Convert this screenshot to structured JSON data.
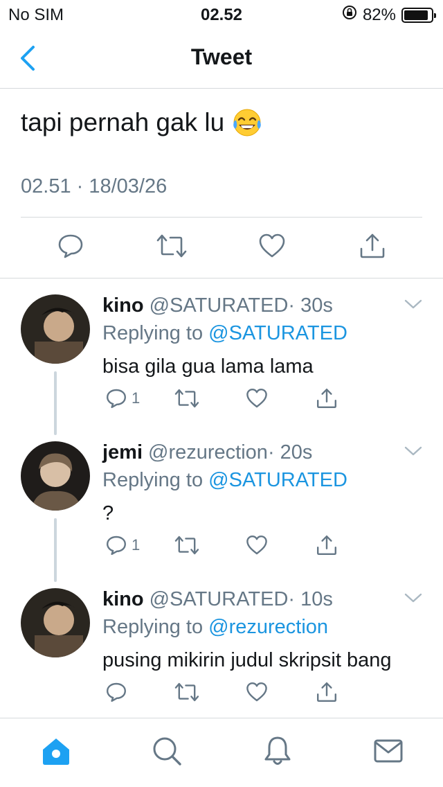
{
  "status_bar": {
    "carrier": "No SIM",
    "time": "02.52",
    "battery": "82%",
    "battery_level": 0.82
  },
  "nav": {
    "title": "Tweet",
    "back_icon": "chevron-left-icon"
  },
  "main_tweet": {
    "text": "tapi pernah gak lu",
    "emoji": "tears-of-joy-emoji",
    "date": "02.51 · 18/03/26",
    "actions": [
      "reply-icon",
      "retweet-icon",
      "like-icon",
      "share-icon"
    ]
  },
  "replies": [
    {
      "name": "kino",
      "handle": "@SATURATED",
      "time": "· 30s",
      "replying_label": "Replying to",
      "replying_to": "@SATURATED",
      "text": "bisa gila gua lama lama",
      "reply_count": "1"
    },
    {
      "name": "jemi",
      "handle": "@rezurection",
      "time": "· 20s",
      "replying_label": "Replying to",
      "replying_to": "@SATURATED",
      "text": "?",
      "reply_count": "1"
    },
    {
      "name": "kino",
      "handle": "@SATURATED",
      "time": "· 10s",
      "replying_label": "Replying to",
      "replying_to": "@rezurection",
      "text": "pusing mikirin judul skripsit bang",
      "reply_count": ""
    }
  ],
  "tab_bar": {
    "tabs": [
      "home-icon",
      "search-icon",
      "notifications-icon",
      "messages-icon"
    ],
    "active": "home-icon"
  },
  "colors": {
    "accent": "#1da1f2",
    "link": "#1b95e0",
    "muted": "#657786",
    "icon": "#657786",
    "divider": "#d6d9dc"
  }
}
